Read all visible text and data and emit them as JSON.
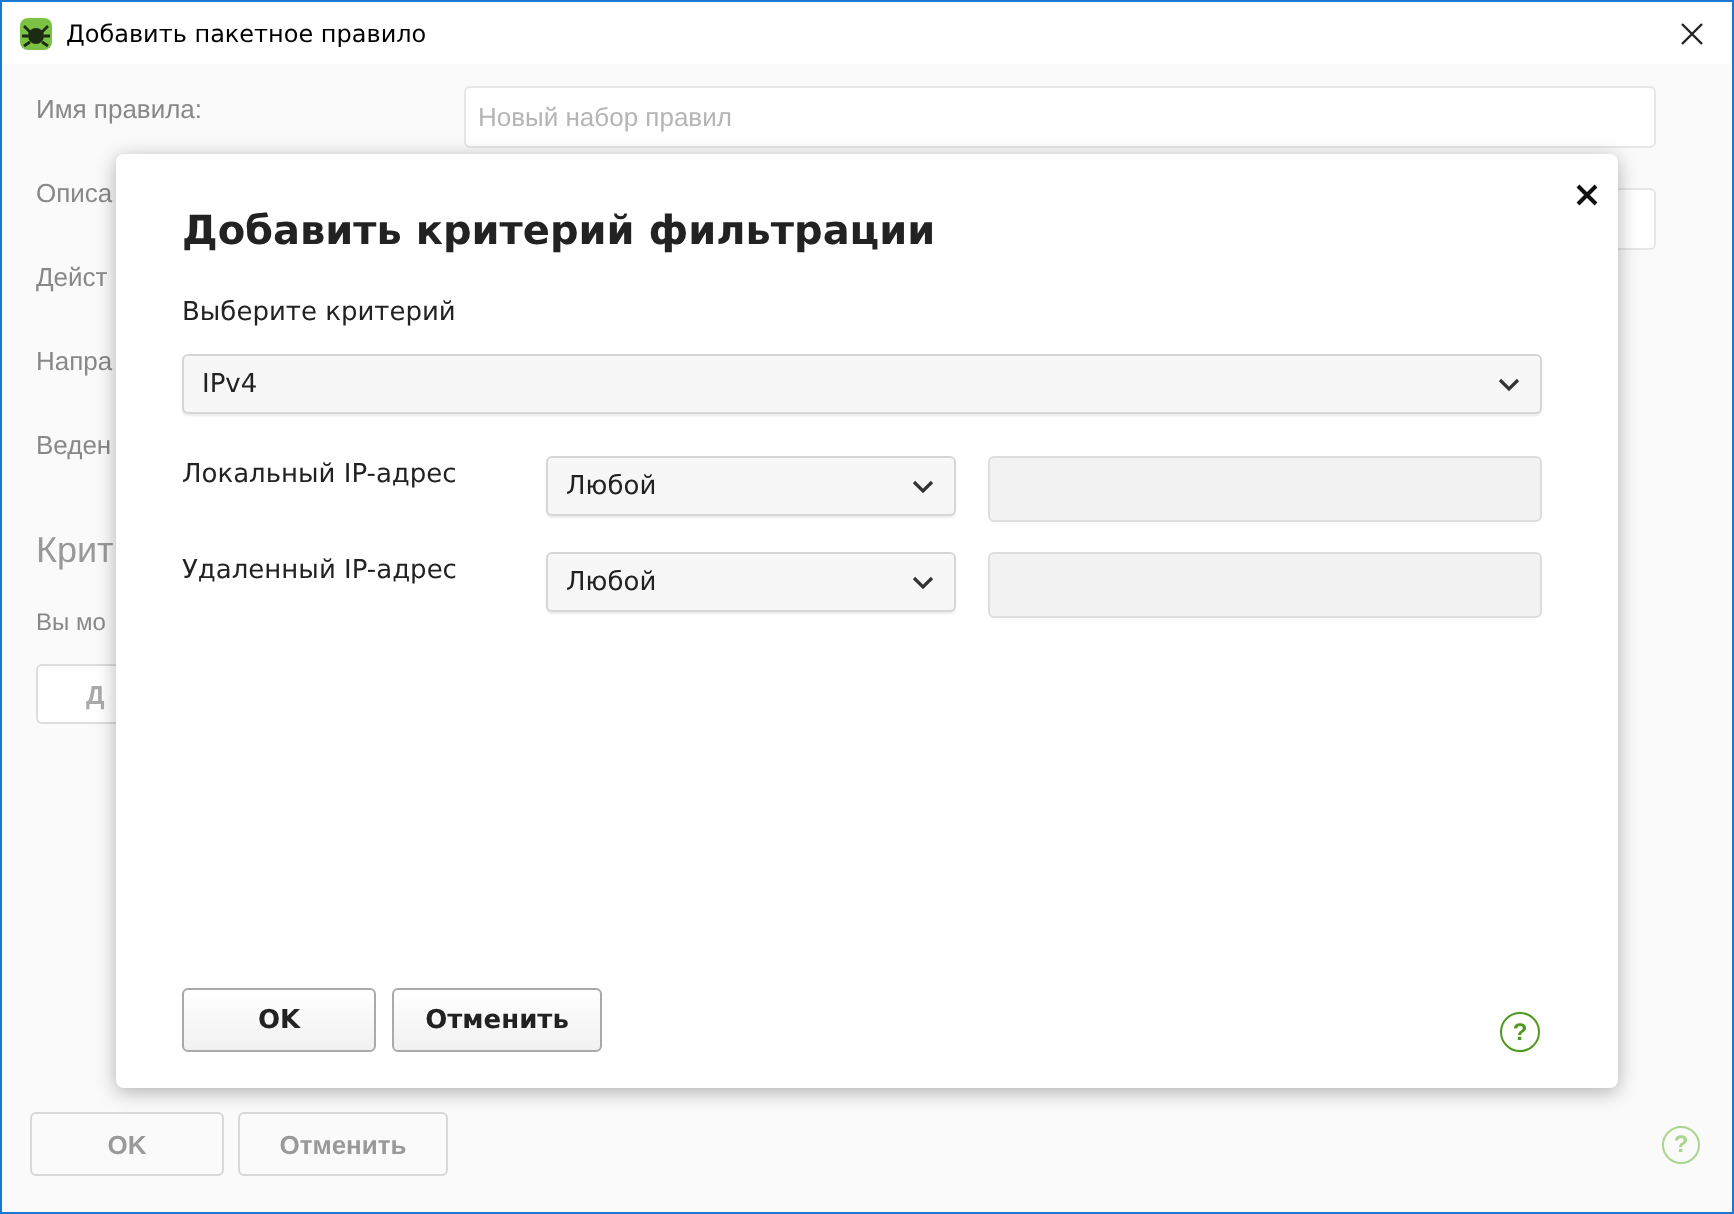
{
  "window": {
    "title": "Добавить пакетное правило"
  },
  "background": {
    "disabled": true,
    "fields": [
      {
        "label": "Имя правила:",
        "placeholder": "Новый набор правил"
      },
      {
        "label": "Описа"
      }
    ],
    "labels": [
      "Дейст",
      "Напра",
      "Веден"
    ],
    "section_title": "Крит",
    "section_text": "Вы мо",
    "add_button": "Д",
    "buttons": [
      "OK",
      "Отменить"
    ],
    "help": "?"
  },
  "dialog": {
    "title": "Добавить критерий фильтрации",
    "criterion_label": "Выберите критерий",
    "criterion": "IPv4",
    "rows": [
      {
        "label": "Локальный IP-адрес",
        "value": "Любой",
        "address_disabled": true
      },
      {
        "label": "Удаленный IP-адрес",
        "value": "Любой",
        "address_disabled": true
      }
    ],
    "buttons": [
      "OK",
      "Отменить"
    ],
    "help": "?"
  }
}
